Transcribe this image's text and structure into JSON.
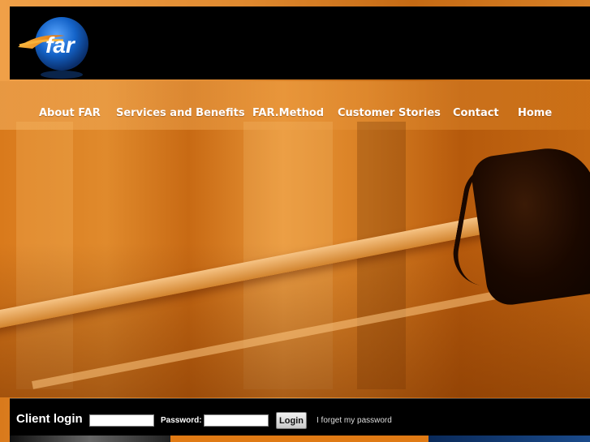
{
  "brand": {
    "logo_text": "far",
    "logo_icon": "far-globe-logo"
  },
  "nav": {
    "items": [
      {
        "label": "About FAR"
      },
      {
        "label": "Services and Benefits"
      },
      {
        "label": "FAR.Method"
      },
      {
        "label": "Customer Stories"
      },
      {
        "label": "Contact"
      },
      {
        "label": "Home"
      }
    ]
  },
  "login": {
    "title": "Client login",
    "username_value": "",
    "password_label": "Password:",
    "password_value": "",
    "button_label": "Login",
    "forgot_label": "I forget my password"
  },
  "colors": {
    "accent": "#e07a14",
    "header_bg": "#000000",
    "nav_text": "#ffffff"
  }
}
